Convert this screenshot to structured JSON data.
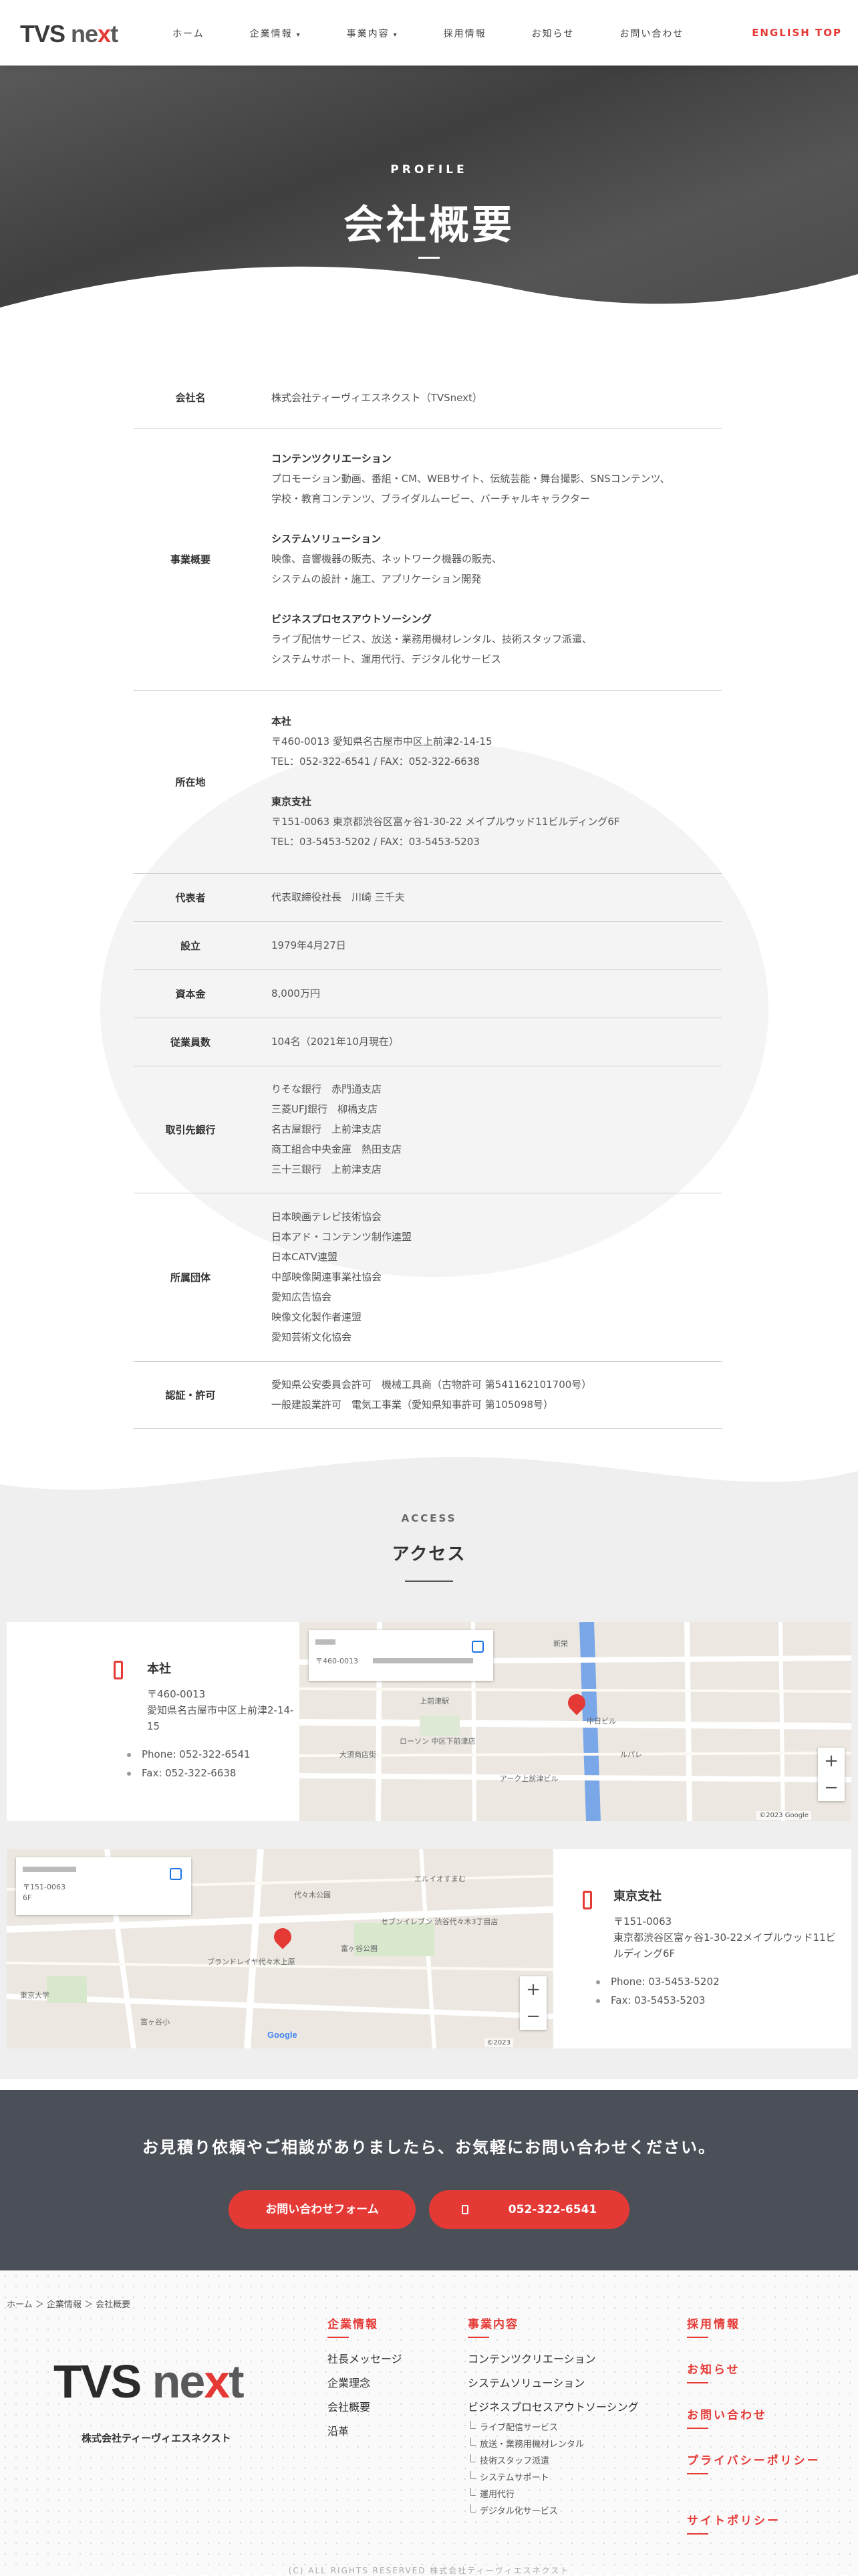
{
  "header": {
    "logo_a": "TVS",
    "logo_b": "ne",
    "logo_c": "x",
    "logo_d": "t",
    "nav": [
      {
        "label": "ホーム",
        "caret": ""
      },
      {
        "label": "企業情報",
        "caret": "▾"
      },
      {
        "label": "事業内容",
        "caret": "▾"
      },
      {
        "label": "採用情報",
        "caret": ""
      },
      {
        "label": "お知らせ",
        "caret": ""
      },
      {
        "label": "お問い合わせ",
        "caret": ""
      }
    ],
    "english": "ENGLISH TOP"
  },
  "hero": {
    "sub": "PROFILE",
    "title": "会社概要"
  },
  "profile": {
    "company_label": "会社名",
    "company_value": "株式会社ティーヴィエスネクスト（TVSnext）",
    "business_label": "事業概要",
    "business": [
      {
        "head": "コンテンツクリエーション",
        "lines": [
          "プロモーション動画、番組・CM、WEBサイト、伝統芸能・舞台撮影、SNSコンテンツ、",
          "学校・教育コンテンツ、ブライダルムービー、バーチャルキャラクター"
        ]
      },
      {
        "head": "システムソリューション",
        "lines": [
          "映像、音響機器の販売、ネットワーク機器の販売、",
          "システムの設計・施工、アプリケーション開発"
        ]
      },
      {
        "head": "ビジネスプロセスアウトソーシング",
        "lines": [
          "ライブ配信サービス、放送・業務用機材レンタル、技術スタッフ派遣、",
          "システムサポート、運用代行、デジタル化サービス"
        ]
      }
    ],
    "location_label": "所在地",
    "locations": [
      {
        "head": "本社",
        "lines": [
          "〒460-0013 愛知県名古屋市中区上前津2-14-15",
          "TEL：052-322-6541 / FAX：052-322-6638"
        ]
      },
      {
        "head": "東京支社",
        "lines": [
          "〒151-0063 東京都渋谷区富ヶ谷1-30-22 メイプルウッド11ビルディング6F",
          "TEL：03-5453-5202 / FAX：03-5453-5203"
        ]
      }
    ],
    "rep_label": "代表者",
    "rep_value": "代表取締役社長　川崎 三千夫",
    "est_label": "設立",
    "est_value": "1979年4月27日",
    "capital_label": "資本金",
    "capital_value": "8,000万円",
    "staff_label": "従業員数",
    "staff_value": "104名（2021年10月現在）",
    "bank_label": "取引先銀行",
    "banks": [
      "りそな銀行　赤門通支店",
      "三菱UFJ銀行　柳橋支店",
      "名古屋銀行　上前津支店",
      "商工組合中央金庫　熱田支店",
      "三十三銀行　上前津支店"
    ],
    "assoc_label": "所属団体",
    "assocs": [
      "日本映画テレビ技術協会",
      "日本アド・コンテンツ制作連盟",
      "日本CATV連盟",
      "中部映像関連事業社協会",
      "愛知広告協会",
      "映像文化製作者連盟",
      "愛知芸術文化協会"
    ],
    "license_label": "認証・許可",
    "licenses": [
      "愛知県公安委員会許可　機械工具商（古物許可 第541162101700号）",
      "一般建設業許可　電気工事業（愛知県知事許可 第105098号）"
    ]
  },
  "access": {
    "sub": "ACCESS",
    "title": "アクセス",
    "honsha": {
      "name": "本社",
      "addr1": "〒460-0013",
      "addr2": "愛知県名古屋市中区上前津2-14-15",
      "phone": "Phone: 052-322-6541",
      "fax": "Fax: 052-322-6638"
    },
    "tokyo": {
      "name": "東京支社",
      "addr1": "〒151-0063",
      "addr2": "東京都渋谷区富ヶ谷1-30-22メイプルウッド11ビルディング6F",
      "phone": "Phone: 03-5453-5202",
      "fax": "Fax: 03-5453-5203"
    },
    "map1": {
      "info_line": "〒460-0013 ",
      "google": "Google",
      "copyright": "©2023 Google",
      "labels": [
        "新栄",
        "上前津駅",
        "大須商店街",
        "中日ビル",
        "ルパレ",
        "ローソン 中区下前津店",
        "アーク上前津ビル"
      ]
    },
    "map2": {
      "info_line": "〒151-0063 ",
      "info_sub": "6F",
      "google": "Google",
      "copyright": "©2023",
      "labels": [
        "エルイオすまむ",
        "セブンイレブン 渋谷代々木3丁目店",
        "代々木公園",
        "富ヶ谷公園",
        "東京大学",
        "ブランドレイヤ代々木上原",
        "富ヶ谷小"
      ]
    },
    "zoom_in": "+",
    "zoom_out": "−"
  },
  "cta": {
    "text": "お見積り依頼やご相談がありましたら、お気軽にお問い合わせください。",
    "form_button": "お問い合わせフォーム",
    "phone_button": "052-322-6541"
  },
  "footer": {
    "breadcrumb": "ホーム ＞ 企業情報 ＞ 会社概要",
    "logo_a": "TVS",
    "logo_b": "ne",
    "logo_c": "x",
    "logo_d": "t",
    "company": "株式会社ティーヴィエスネクスト",
    "col1": {
      "title": "企業情報",
      "items": [
        "社長メッセージ",
        "企業理念",
        "会社概要",
        "沿革"
      ]
    },
    "col2": {
      "title": "事業内容",
      "items": [
        "コンテンツクリエーション",
        "システムソリューション",
        "ビジネスプロセスアウトソーシング"
      ],
      "subs": [
        "ライブ配信サービス",
        "放送・業務用機材レンタル",
        "技術スタッフ派遣",
        "システムサポート",
        "運用代行",
        "デジタル化サービス"
      ]
    },
    "links": [
      "採用情報",
      "お知らせ",
      "お問い合わせ",
      "プライバシーポリシー",
      "サイトポリシー"
    ],
    "copyright": "(C) ALL RIGHTS RESERVED 株式会社ティーヴィエスネクスト"
  },
  "colors": {
    "accent": "#e53935",
    "dark": "#4b4f58"
  }
}
